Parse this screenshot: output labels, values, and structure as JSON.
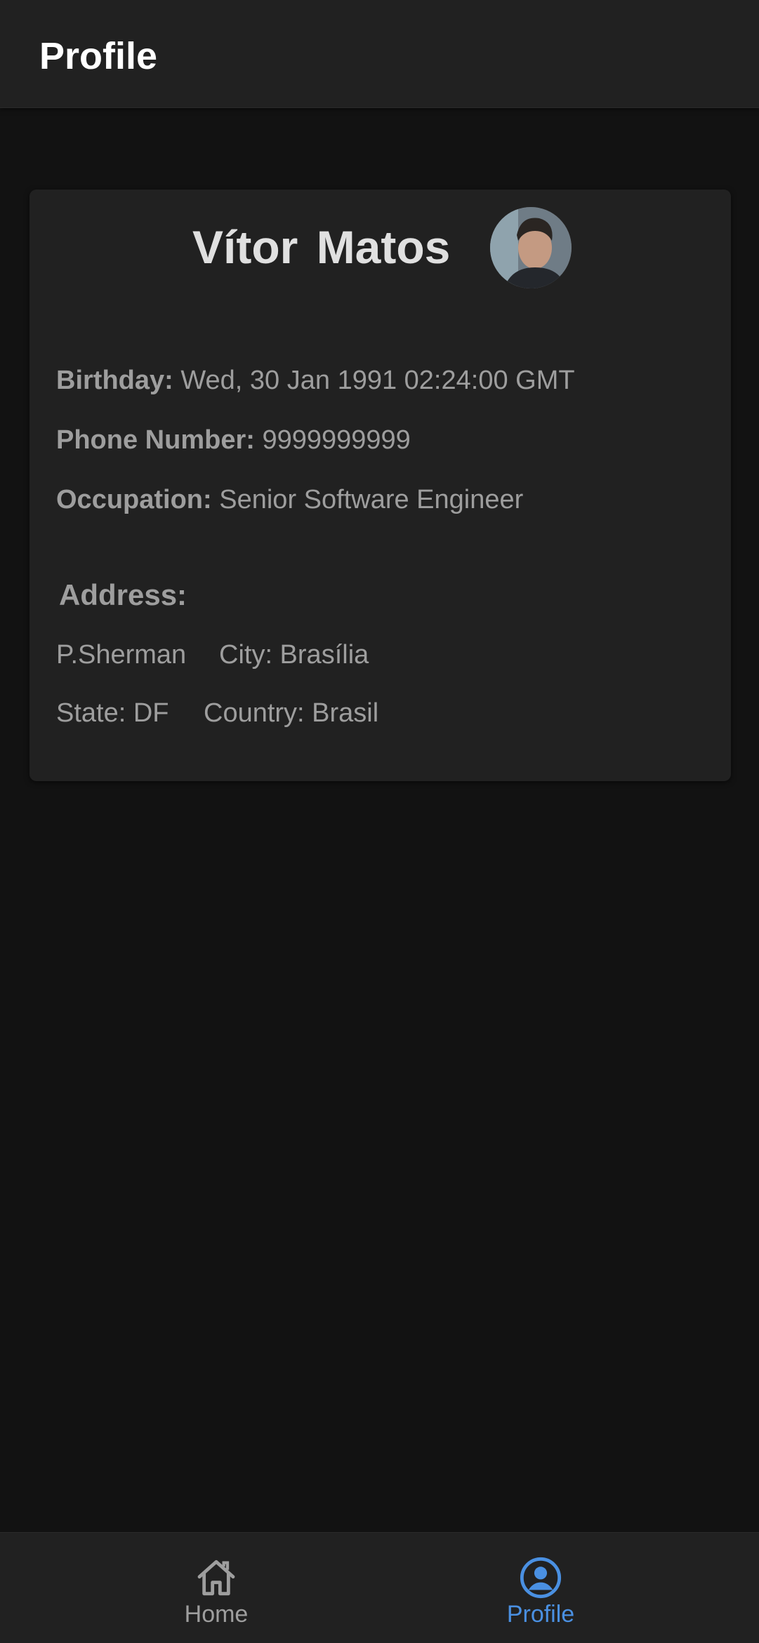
{
  "app_bar": {
    "title": "Profile"
  },
  "profile": {
    "first_name": "Vítor",
    "last_name": "Matos",
    "avatar_icon": "user-photo-avatar",
    "birthday_label": "Birthday:",
    "birthday_value": "Wed, 30 Jan 1991 02:24:00 GMT",
    "phone_label": "Phone Number:",
    "phone_value": "9999999999",
    "occupation_label": "Occupation:",
    "occupation_value": "Senior Software Engineer",
    "address_heading": "Address:",
    "address": {
      "street": "P.Sherman",
      "city": "City: Brasília",
      "state": "State: DF",
      "country": "Country: Brasil"
    }
  },
  "bottom_nav": {
    "items": [
      {
        "label": "Home",
        "icon": "home-icon",
        "active": false
      },
      {
        "label": "Profile",
        "icon": "account-circle-icon",
        "active": true
      }
    ],
    "active_color": "#4a90e2",
    "inactive_color": "#9e9e9e"
  },
  "colors": {
    "background": "#121212",
    "surface": "#212121",
    "text_primary": "#e0e0e0",
    "text_secondary": "#9e9e9e"
  }
}
